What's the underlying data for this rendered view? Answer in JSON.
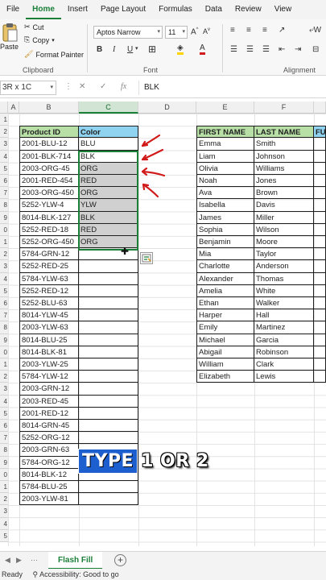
{
  "ribbon": {
    "tabs": [
      "File",
      "Home",
      "Insert",
      "Page Layout",
      "Formulas",
      "Data",
      "Review",
      "View"
    ],
    "active_tab": "Home",
    "clipboard": {
      "paste": "Paste",
      "cut": "Cut",
      "copy": "Copy",
      "format_painter": "Format Painter",
      "label": "Clipboard"
    },
    "font": {
      "name": "Aptos Narrow",
      "size": "11",
      "label": "Font"
    },
    "alignment": {
      "label": "Alignment",
      "wrap": "W"
    }
  },
  "formula_bar": {
    "name_box": "3R x 1C",
    "fx": "fx",
    "cancel": "✕",
    "confirm": "✓",
    "content": "BLK"
  },
  "columns": [
    "A",
    "B",
    "C",
    "D",
    "E",
    "F",
    "FU"
  ],
  "row_numbers": [
    "1",
    "2",
    "3",
    "4",
    "5",
    "6",
    "7",
    "8",
    "9",
    "0",
    "1",
    "2",
    "3",
    "4",
    "5",
    "6",
    "7",
    "8",
    "9",
    "0",
    "1",
    "2",
    "3",
    "4",
    "5",
    "6",
    "7",
    "8",
    "9",
    "0",
    "1",
    "2",
    "3",
    "4",
    "5"
  ],
  "product_table": {
    "headers": [
      "Product ID",
      "Color"
    ],
    "rows": [
      [
        "2001-BLU-12",
        "BLU"
      ],
      [
        "2001-BLK-714",
        "BLK"
      ],
      [
        "2003-ORG-45",
        "ORG"
      ],
      [
        "2001-RED-454",
        "RED"
      ],
      [
        "2003-ORG-450",
        "ORG"
      ],
      [
        "5252-YLW-4",
        "YLW"
      ],
      [
        "8014-BLK-127",
        "BLK"
      ],
      [
        "5252-RED-18",
        "RED"
      ],
      [
        "5252-ORG-450",
        "ORG"
      ],
      [
        "5784-GRN-12",
        ""
      ],
      [
        "5252-RED-25",
        ""
      ],
      [
        "5784-YLW-63",
        ""
      ],
      [
        "5252-RED-12",
        ""
      ],
      [
        "5252-BLU-63",
        ""
      ],
      [
        "8014-YLW-45",
        ""
      ],
      [
        "2003-YLW-63",
        ""
      ],
      [
        "8014-BLU-25",
        ""
      ],
      [
        "8014-BLK-81",
        ""
      ],
      [
        "2003-YLW-25",
        ""
      ],
      [
        "5784-YLW-12",
        ""
      ],
      [
        "2003-GRN-12",
        ""
      ],
      [
        "2003-RED-45",
        ""
      ],
      [
        "2001-RED-12",
        ""
      ],
      [
        "8014-GRN-45",
        ""
      ],
      [
        "5252-ORG-12",
        ""
      ],
      [
        "2003-GRN-63",
        ""
      ],
      [
        "5784-ORG-12",
        ""
      ],
      [
        "8014-BLK-12",
        ""
      ],
      [
        "5784-BLU-25",
        ""
      ],
      [
        "2003-YLW-81",
        ""
      ]
    ]
  },
  "names_table": {
    "headers": [
      "FIRST NAME",
      "LAST NAME",
      "FU"
    ],
    "rows": [
      [
        "Emma",
        "Smith"
      ],
      [
        "Liam",
        "Johnson"
      ],
      [
        "Olivia",
        "Williams"
      ],
      [
        "Noah",
        "Jones"
      ],
      [
        "Ava",
        "Brown"
      ],
      [
        "Isabella",
        "Davis"
      ],
      [
        "James",
        "Miller"
      ],
      [
        "Sophia",
        "Wilson"
      ],
      [
        "Benjamin",
        "Moore"
      ],
      [
        "Mia",
        "Taylor"
      ],
      [
        "Charlotte",
        "Anderson"
      ],
      [
        "Alexander",
        "Thomas"
      ],
      [
        "Amelia",
        "White"
      ],
      [
        "Ethan",
        "Walker"
      ],
      [
        "Harper",
        "Hall"
      ],
      [
        "Emily",
        "Martinez"
      ],
      [
        "Michael",
        "Garcia"
      ],
      [
        "Abigail",
        "Robinson"
      ],
      [
        "William",
        "Clark"
      ],
      [
        "Elizabeth",
        "Lewis"
      ]
    ]
  },
  "caption": {
    "highlight": "TYPE",
    "rest": "1 OR 2"
  },
  "sheet": {
    "tab": "Flash Fill",
    "add": "+"
  },
  "status": {
    "ready": "Ready",
    "accessibility": "Accessibility: Good to go"
  },
  "colors": {
    "accent": "#1a7f37",
    "header_green": "#b7dfa6",
    "header_blue": "#8fd3f1",
    "arrow_red": "#d11a1a"
  }
}
